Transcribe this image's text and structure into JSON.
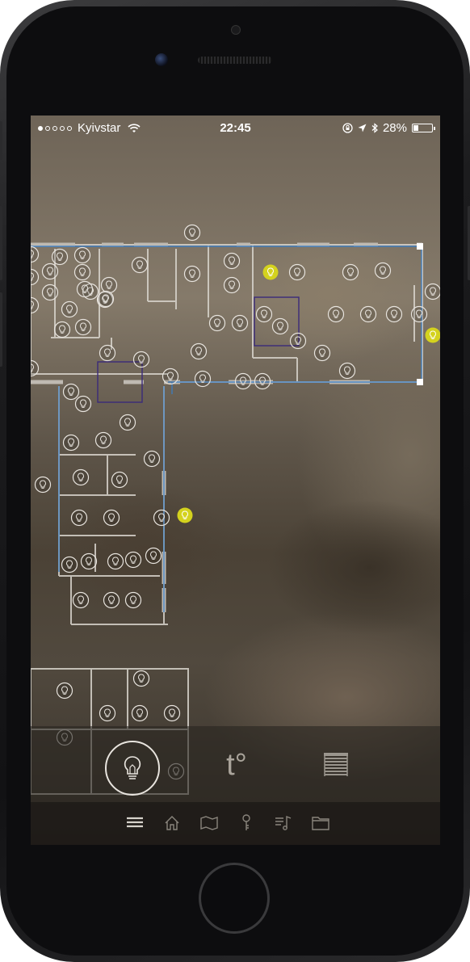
{
  "status_bar": {
    "signal_strength_dots": 1,
    "signal_total_dots": 5,
    "carrier": "Kyivstar",
    "time": "22:45",
    "battery_percent": "28%",
    "battery_level": 0.28
  },
  "colors": {
    "active_light": "#d4d21e",
    "inactive_light_stroke": "#e8e4de",
    "wall": "#d8d4cc",
    "wall_outline_blue": "#3b7ec4",
    "room_outline_purple": "#3a2a7a"
  },
  "floor_plan": {
    "lights_total": 84,
    "lights_on": 3
  },
  "control_modes": [
    {
      "id": "lighting",
      "label": "",
      "icon": "lightbulb-icon",
      "selected": true
    },
    {
      "id": "temperature",
      "label": "t°",
      "icon": "thermometer-text-icon",
      "selected": false
    },
    {
      "id": "blinds",
      "label": "",
      "icon": "blinds-icon",
      "selected": false
    }
  ],
  "tab_bar": [
    {
      "id": "menu",
      "icon": "menu-icon",
      "active": true
    },
    {
      "id": "home",
      "icon": "home-icon",
      "active": false
    },
    {
      "id": "map",
      "icon": "map-icon",
      "active": false
    },
    {
      "id": "key",
      "icon": "key-icon",
      "active": false
    },
    {
      "id": "music",
      "icon": "music-icon",
      "active": false
    },
    {
      "id": "folder",
      "icon": "folder-icon",
      "active": false
    }
  ]
}
